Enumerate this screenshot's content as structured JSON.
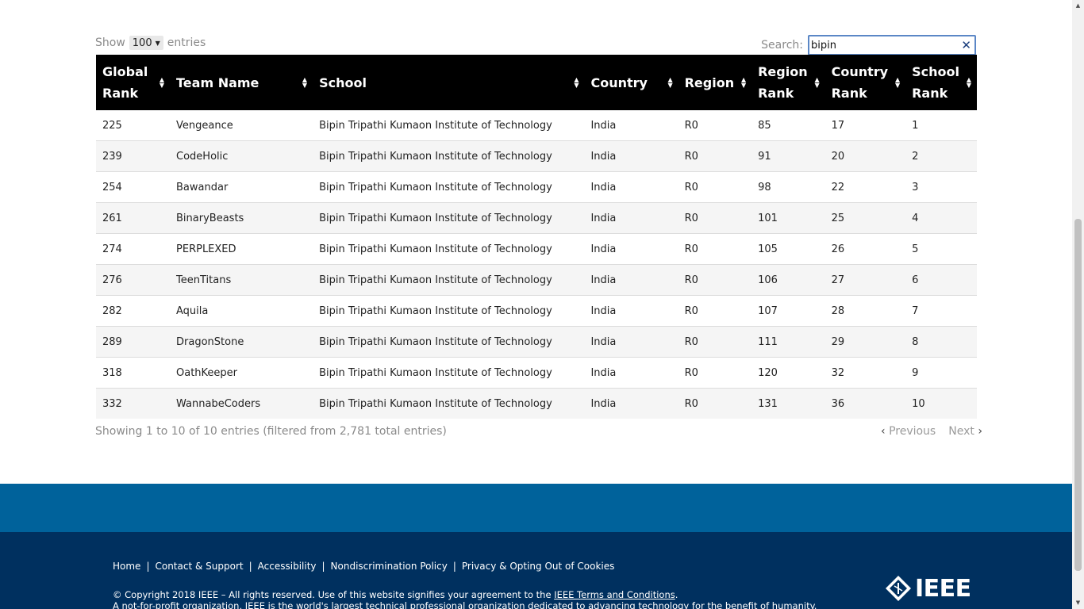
{
  "controls": {
    "show_label": "Show",
    "entries_value": "100",
    "entries_label": "entries",
    "search_label": "Search:",
    "search_value": "bipin"
  },
  "table": {
    "headers": [
      "Global Rank",
      "Team Name",
      "School",
      "Country",
      "Region",
      "Region Rank",
      "Country Rank",
      "School Rank"
    ],
    "rows": [
      [
        "225",
        "Vengeance",
        "Bipin Tripathi Kumaon Institute of Technology",
        "India",
        "R0",
        "85",
        "17",
        "1"
      ],
      [
        "239",
        "CodeHolic",
        "Bipin Tripathi Kumaon Institute of Technology",
        "India",
        "R0",
        "91",
        "20",
        "2"
      ],
      [
        "254",
        "Bawandar",
        "Bipin Tripathi Kumaon Institute of Technology",
        "India",
        "R0",
        "98",
        "22",
        "3"
      ],
      [
        "261",
        "BinaryBeasts",
        "Bipin Tripathi Kumaon Institute of Technology",
        "India",
        "R0",
        "101",
        "25",
        "4"
      ],
      [
        "274",
        "PERPLEXED",
        "Bipin Tripathi Kumaon Institute of Technology",
        "India",
        "R0",
        "105",
        "26",
        "5"
      ],
      [
        "276",
        "TeenTitans",
        "Bipin Tripathi Kumaon Institute of Technology",
        "India",
        "R0",
        "106",
        "27",
        "6"
      ],
      [
        "282",
        "Aquila",
        "Bipin Tripathi Kumaon Institute of Technology",
        "India",
        "R0",
        "107",
        "28",
        "7"
      ],
      [
        "289",
        "DragonStone",
        "Bipin Tripathi Kumaon Institute of Technology",
        "India",
        "R0",
        "111",
        "29",
        "8"
      ],
      [
        "318",
        "OathKeeper",
        "Bipin Tripathi Kumaon Institute of Technology",
        "India",
        "R0",
        "120",
        "32",
        "9"
      ],
      [
        "332",
        "WannabeCoders",
        "Bipin Tripathi Kumaon Institute of Technology",
        "India",
        "R0",
        "131",
        "36",
        "10"
      ]
    ]
  },
  "info_text": "Showing 1 to 10 of 10 entries (filtered from 2,781 total entries)",
  "pagination": {
    "previous": "Previous",
    "next": "Next"
  },
  "footer": {
    "links": [
      "Home",
      "Contact & Support",
      "Accessibility",
      "Nondiscrimination Policy",
      "Privacy & Opting Out of Cookies"
    ],
    "copyright_prefix": "© Copyright 2018 IEEE – All rights reserved. Use of this website signifies your agreement to the ",
    "terms_link": "IEEE Terms and Conditions",
    "copyright_suffix": ".",
    "tagline": "A not-for-profit organization, IEEE is the world's largest technical professional organization dedicated to advancing technology for the benefit of humanity.",
    "logo_text": "IEEE"
  },
  "colors": {
    "header_bg": "#000000",
    "band_blue": "#00629b",
    "footer_navy": "#00305f",
    "search_border": "#5b87c6"
  }
}
